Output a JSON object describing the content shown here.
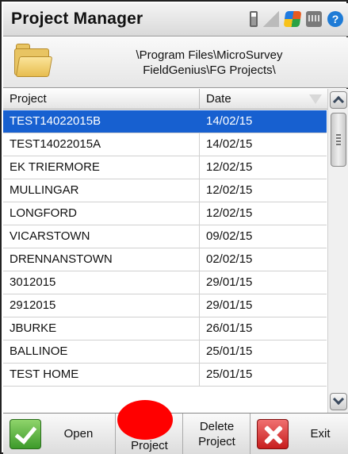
{
  "titlebar": {
    "title": "Project Manager",
    "tray_icons": [
      "battery-icon",
      "signal-icon",
      "windows-icon",
      "keyboard-icon",
      "help-icon"
    ],
    "help_glyph": "?"
  },
  "path": {
    "icon": "folder-icon",
    "line1": "\\Program Files\\MicroSurvey",
    "line2": "FieldGenius\\FG Projects\\"
  },
  "table": {
    "columns": [
      "Project",
      "Date"
    ],
    "rows": [
      {
        "project": "TEST14022015B",
        "date": "14/02/15",
        "selected": true
      },
      {
        "project": "TEST14022015A",
        "date": "14/02/15"
      },
      {
        "project": "EK TRIERMORE",
        "date": "12/02/15"
      },
      {
        "project": "MULLINGAR",
        "date": "12/02/15"
      },
      {
        "project": "LONGFORD",
        "date": "12/02/15"
      },
      {
        "project": "VICARSTOWN",
        "date": "09/02/15"
      },
      {
        "project": "DRENNANSTOWN",
        "date": "02/02/15"
      },
      {
        "project": "3012015",
        "date": "29/01/15"
      },
      {
        "project": "2912015",
        "date": "29/01/15"
      },
      {
        "project": "JBURKE",
        "date": "26/01/15"
      },
      {
        "project": "BALLINOE",
        "date": "25/01/15"
      },
      {
        "project": "TEST HOME",
        "date": "25/01/15"
      }
    ]
  },
  "toolbar": {
    "open": "Open",
    "new_partial": "Project",
    "delete_line1": "Delete",
    "delete_line2": "Project",
    "exit": "Exit"
  },
  "colors": {
    "selection": "#1760d0",
    "redaction": "#ff0000"
  }
}
